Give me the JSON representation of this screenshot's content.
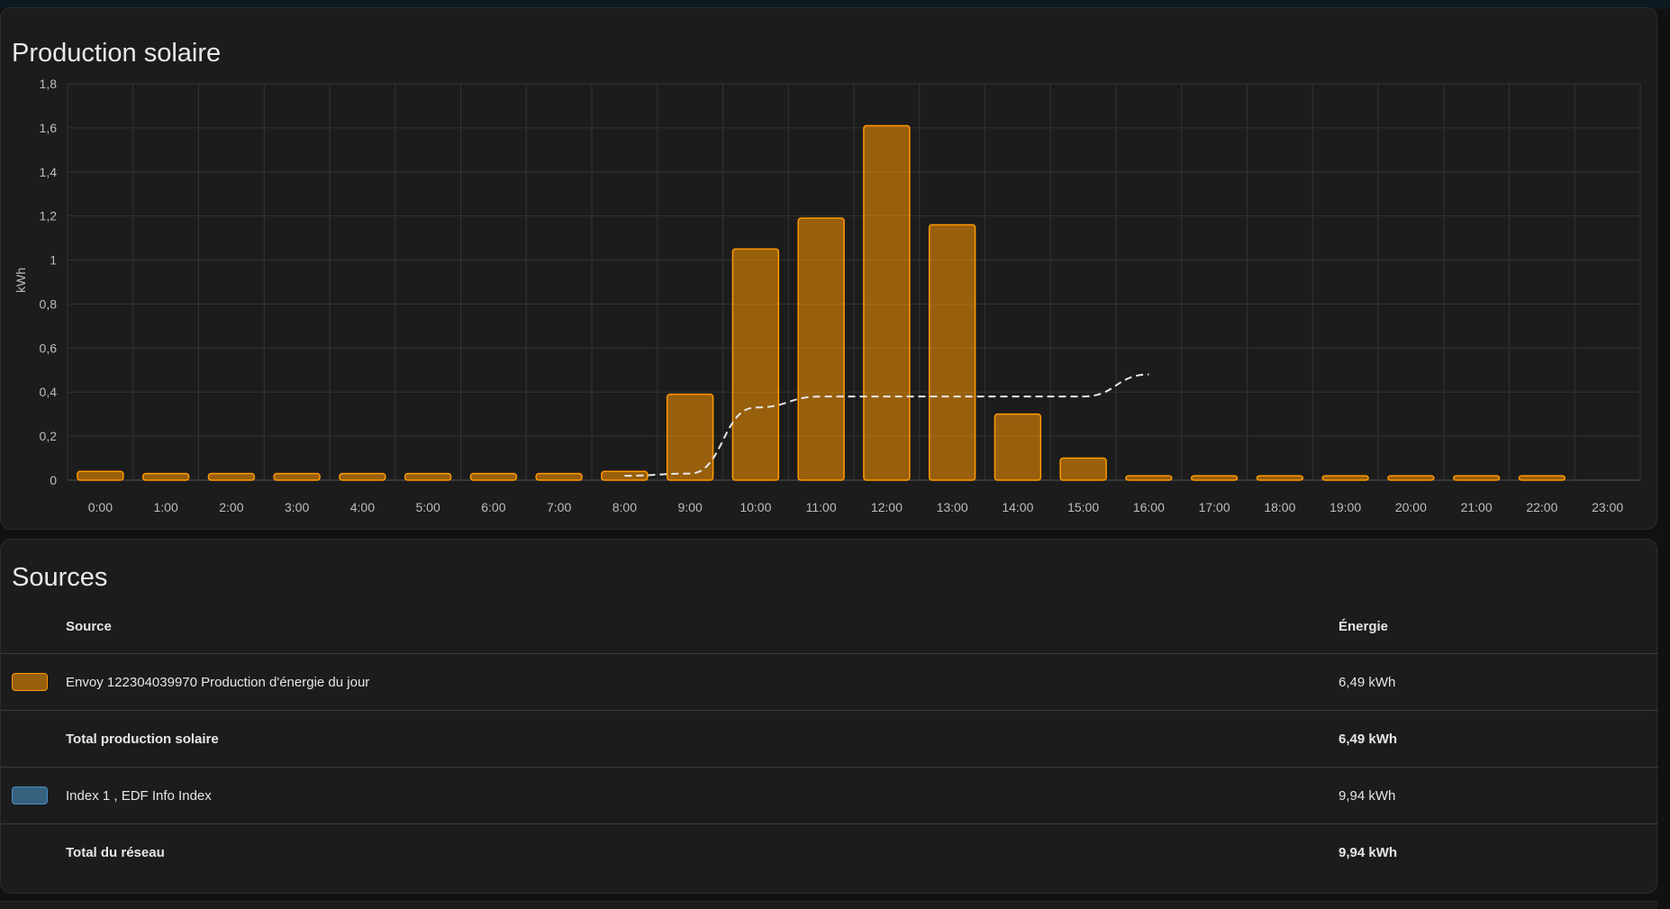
{
  "chart_card": {
    "title": "Production solaire"
  },
  "chart_data": {
    "type": "bar",
    "ylabel": "kWh",
    "ylim": [
      0,
      1.8
    ],
    "yticks": [
      "0",
      "0,2",
      "0,4",
      "0,6",
      "0,8",
      "1",
      "1,2",
      "1,4",
      "1,6",
      "1,8"
    ],
    "categories": [
      "0:00",
      "1:00",
      "2:00",
      "3:00",
      "4:00",
      "5:00",
      "6:00",
      "7:00",
      "8:00",
      "9:00",
      "10:00",
      "11:00",
      "12:00",
      "13:00",
      "14:00",
      "15:00",
      "16:00",
      "17:00",
      "18:00",
      "19:00",
      "20:00",
      "21:00",
      "22:00",
      "23:00"
    ],
    "series": [
      {
        "type": "bar",
        "color": "#ff9800",
        "values": [
          0.04,
          0.03,
          0.03,
          0.03,
          0.03,
          0.03,
          0.03,
          0.03,
          0.04,
          0.39,
          1.05,
          1.19,
          1.61,
          1.16,
          0.3,
          0.1,
          0.02,
          0.02,
          0.02,
          0.02,
          0.02,
          0.02,
          0.02,
          null
        ]
      },
      {
        "type": "line",
        "style": "dashed",
        "color": "#e8e8e8",
        "values": [
          null,
          null,
          null,
          null,
          null,
          null,
          null,
          null,
          0.02,
          0.03,
          0.33,
          0.38,
          0.38,
          0.38,
          0.38,
          0.38,
          0.48,
          null,
          null,
          null,
          null,
          null,
          null,
          null
        ]
      }
    ],
    "grid": true
  },
  "sources_card": {
    "title": "Sources",
    "headers": {
      "source": "Source",
      "energy": "Énergie"
    },
    "rows": [
      {
        "color": "#ff9800",
        "source": "Envoy 122304039970 Production d'énergie du jour",
        "energy": "6,49 kWh",
        "total": false
      },
      {
        "color": null,
        "source": "Total production solaire",
        "energy": "6,49 kWh",
        "total": true
      },
      {
        "color": "#488fc2",
        "source": "Index 1 , EDF Info Index",
        "energy": "9,94 kWh",
        "total": false
      },
      {
        "color": null,
        "source": "Total du réseau",
        "energy": "9,94 kWh",
        "total": true
      }
    ]
  }
}
